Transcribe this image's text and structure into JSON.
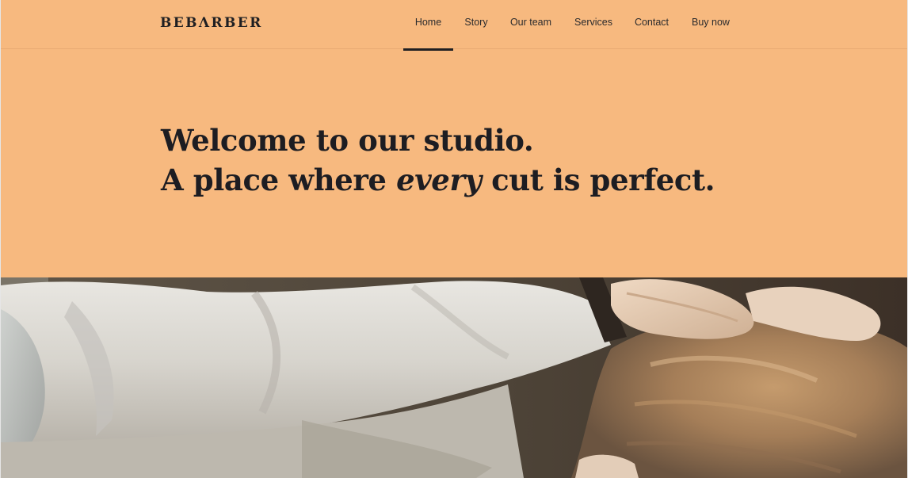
{
  "header": {
    "brand": "BEBΛRBER",
    "nav": [
      {
        "label": "Home",
        "active": true
      },
      {
        "label": "Story",
        "active": false
      },
      {
        "label": "Our team",
        "active": false
      },
      {
        "label": "Services",
        "active": false
      },
      {
        "label": "Contact",
        "active": false
      },
      {
        "label": "Buy now",
        "active": false
      }
    ]
  },
  "hero": {
    "line1": "Welcome to our studio.",
    "line2_before": "A place where ",
    "line2_emphasis": "every",
    "line2_after": " cut is perfect."
  },
  "media": {
    "photo_subject": "barber-cutting-hair-photo"
  },
  "colors": {
    "background": "#f7b97f",
    "text": "#1d1d22",
    "active_indicator": "#1f1f22"
  }
}
